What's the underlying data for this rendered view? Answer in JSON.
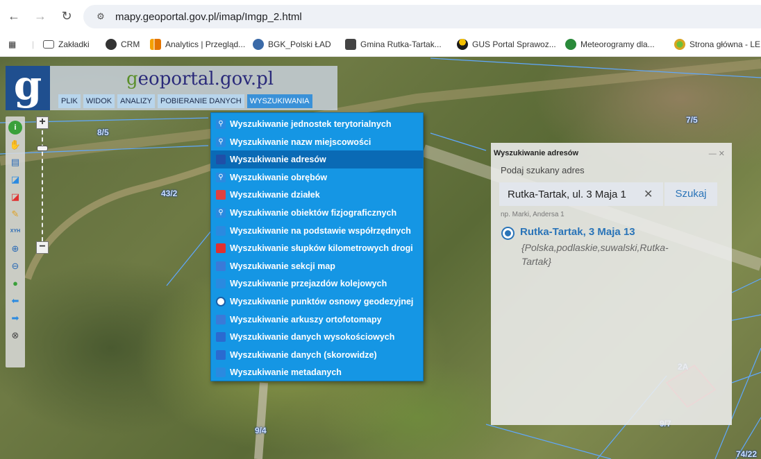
{
  "browser": {
    "url": "mapy.geoportal.gov.pl/imap/Imgp_2.html",
    "bookmarks": [
      {
        "label": "Zakładki",
        "color": "#555555"
      },
      {
        "label": "CRM",
        "color": "#333333"
      },
      {
        "label": "Analytics | Przegląd...",
        "color": "#f4a000"
      },
      {
        "label": "BGK_Polski ŁAD",
        "color": "#3b6aa8"
      },
      {
        "label": "Gmina Rutka-Tartak...",
        "color": "#444444"
      },
      {
        "label": "GUS Portal Sprawoz...",
        "color": "#1a1a1a"
      },
      {
        "label": "Meteorogramy dla...",
        "color": "#2a8a3a"
      },
      {
        "label": "Strona główna - LE",
        "color": "#d9a520"
      }
    ]
  },
  "app": {
    "logo_letter": "g",
    "title_prefix": "g",
    "title_rest": "eoportal.gov.pl",
    "menu": [
      "PLIK",
      "WIDOK",
      "ANALIZY",
      "POBIERANIE DANYCH",
      "WYSZUKIWANIA"
    ],
    "active_menu": "WYSZUKIWANIA"
  },
  "map_labels": [
    "8/5",
    "43/2",
    "7/5",
    "9/4",
    "9/7",
    "2A",
    "74/22"
  ],
  "dropdown": {
    "selected_index": 2,
    "items": [
      {
        "label": "Wyszukiwanie jednostek terytorialnych",
        "icon": "search-icon",
        "color": "#2a8ae0"
      },
      {
        "label": "Wyszukiwanie nazw miejscowości",
        "icon": "search-icon",
        "color": "#2a8ae0"
      },
      {
        "label": "Wyszukiwanie adresów",
        "icon": "address-icon",
        "color": "#1f4fa8"
      },
      {
        "label": "Wyszukiwanie obrębów",
        "icon": "search-icon",
        "color": "#2a8ae0"
      },
      {
        "label": "Wyszukiwanie działek",
        "icon": "parcel-icon",
        "color": "#e04040"
      },
      {
        "label": "Wyszukiwanie obiektów fizjograficznych",
        "icon": "search-icon",
        "color": "#2a8ae0"
      },
      {
        "label": "Wyszukiwanie na podstawie współrzędnych",
        "icon": "coordinates-icon",
        "color": "#2a8ae0"
      },
      {
        "label": "Wyszukiwanie słupków kilometrowych drogi",
        "icon": "milestone-icon",
        "color": "#e03030"
      },
      {
        "label": "Wyszukiwanie sekcji map",
        "icon": "map-section-icon",
        "color": "#3a7ad8"
      },
      {
        "label": "Wyszukiwanie przejazdów kolejowych",
        "icon": "railway-icon",
        "color": "#2a8ae0"
      },
      {
        "label": "Wyszukiwanie punktów osnowy geodezyjnej",
        "icon": "geodetic-point-icon",
        "color": "#ffffff"
      },
      {
        "label": "Wyszukiwanie arkuszy ortofotomapy",
        "icon": "ortho-sheet-icon",
        "color": "#3a7ad8"
      },
      {
        "label": "Wyszukiwanie danych wysokościowych",
        "icon": "elevation-icon",
        "color": "#2a6ad0"
      },
      {
        "label": "Wyszukiwanie danych (skorowidze)",
        "icon": "index-icon",
        "color": "#2a6ad0"
      },
      {
        "label": "Wyszukiwanie metadanych",
        "icon": "metadata-icon",
        "color": "#2a8ae0"
      }
    ]
  },
  "search_panel": {
    "title": "Wyszukiwanie adresów",
    "label": "Podaj szukany adres",
    "input_value": "Rutka-Tartak, ul. 3 Maja 1",
    "clear": "✕",
    "button": "Szukaj",
    "hint": "np. Marki, Andersa 1",
    "result_title": "Rutka-Tartak, 3 Maja 13",
    "result_detail": "{Polska,podlaskie,suwalski,Rutka-Tartak}",
    "window_controls": "— ✕"
  }
}
